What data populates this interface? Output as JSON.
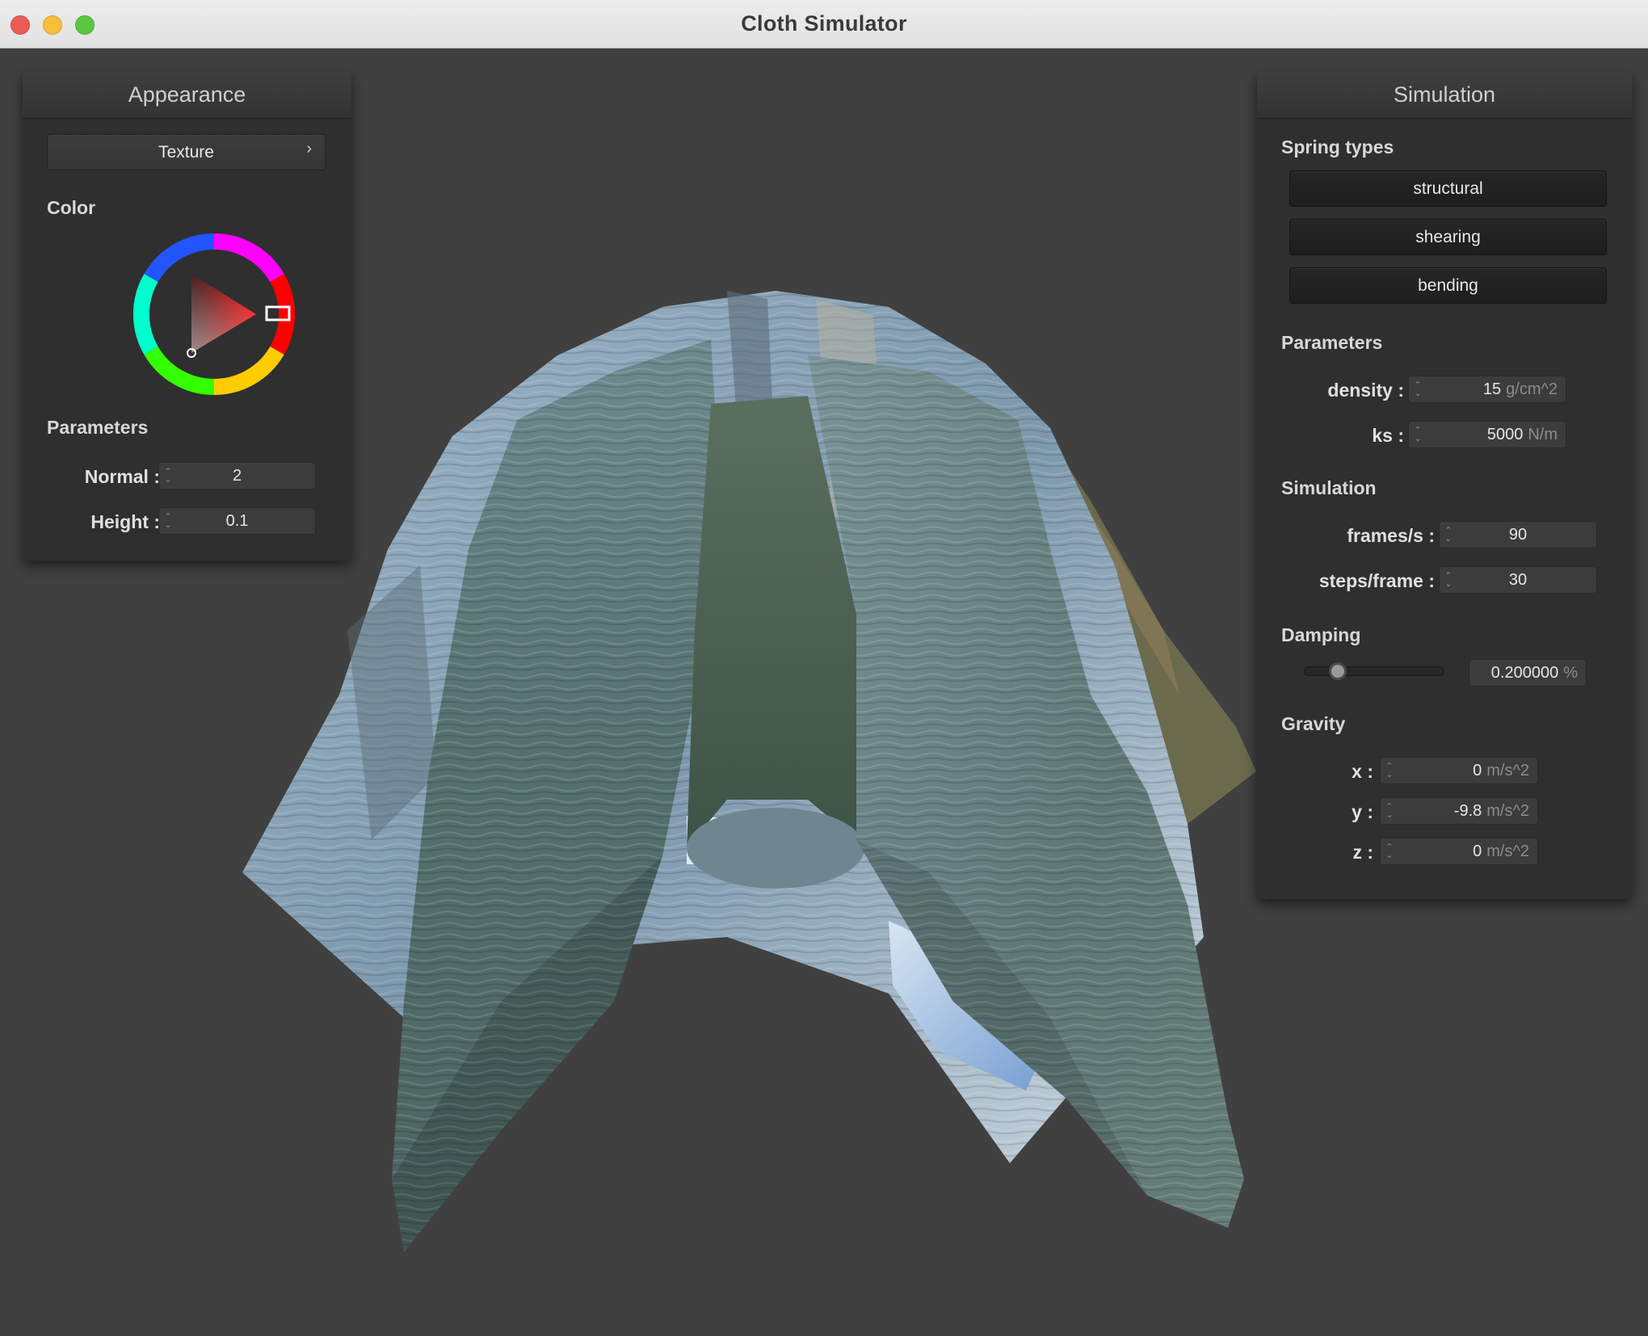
{
  "window": {
    "title": "Cloth Simulator"
  },
  "appearance": {
    "title": "Appearance",
    "texture_button": "Texture",
    "color_label": "Color",
    "color_value": "#ff1a1a",
    "parameters_label": "Parameters",
    "normal_label": "Normal :",
    "normal_value": "2",
    "height_label": "Height :",
    "height_value": "0.1"
  },
  "simulation": {
    "title": "Simulation",
    "spring_types_label": "Spring types",
    "spring_buttons": [
      "structural",
      "shearing",
      "bending"
    ],
    "parameters_label": "Parameters",
    "density_label": "density :",
    "density_value": "15",
    "density_unit": "g/cm^2",
    "ks_label": "ks :",
    "ks_value": "5000",
    "ks_unit": "N/m",
    "simulation_label": "Simulation",
    "fps_label": "frames/s :",
    "fps_value": "90",
    "steps_label": "steps/frame :",
    "steps_value": "30",
    "damping_label": "Damping",
    "damping_value": "0.200000",
    "damping_unit": "%",
    "damping_fraction": 0.2,
    "gravity_label": "Gravity",
    "gx_label": "x :",
    "gx_value": "0",
    "gy_label": "y :",
    "gy_value": "-9.8",
    "gz_label": "z :",
    "gz_value": "0",
    "gravity_unit": "m/s^2"
  },
  "icons": [
    "close-icon",
    "minimize-icon",
    "zoom-icon",
    "chevron-right-icon",
    "spinner-arrows-icon",
    "color-wheel-icon"
  ]
}
